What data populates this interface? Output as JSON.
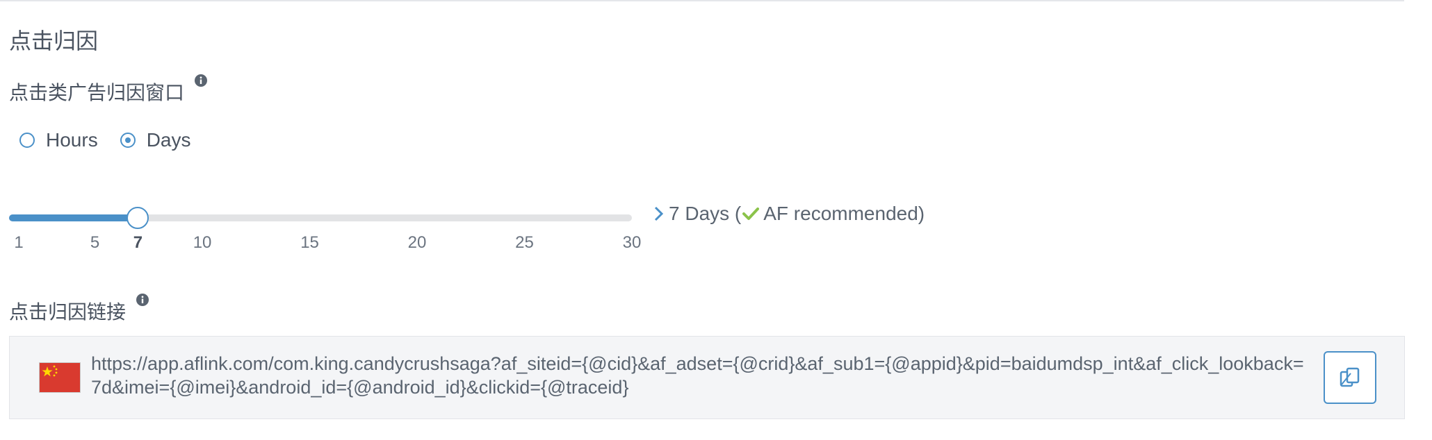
{
  "section": {
    "title": "点击归因"
  },
  "window_field": {
    "label": "点击类广告归因窗口",
    "info_icon": "info-icon"
  },
  "unit_options": [
    {
      "label": "Hours",
      "selected": false
    },
    {
      "label": "Days",
      "selected": true
    }
  ],
  "slider": {
    "min": 1,
    "max": 30,
    "value": 7,
    "ticks": [
      "1",
      "5",
      "7",
      "10",
      "15",
      "20",
      "25",
      "30"
    ],
    "readout_value": "7 Days (",
    "readout_recommended": "AF recommended)",
    "readout_icon": "chevron-right-icon",
    "check_icon": "check-icon",
    "accent_color": "#4a90c8",
    "check_color": "#8bc34a"
  },
  "link_field": {
    "label": "点击归因链接",
    "info_icon": "info-icon",
    "flag_icon": "china-flag-icon",
    "url": "https://app.aflink.com/com.king.candycrushsaga?af_siteid={@cid}&af_adset={@crid}&af_sub1={@appid}&pid=baidumdsp_int&af_click_lookback=7d&imei={@imei}&android_id={@android_id}&clickid={@traceid}",
    "copy_icon": "copy-icon"
  }
}
